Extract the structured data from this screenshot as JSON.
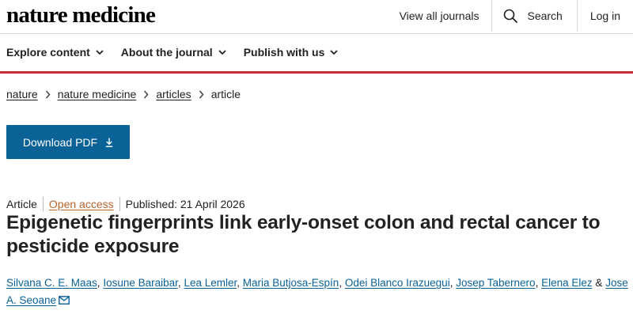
{
  "header": {
    "logo": "nature medicine",
    "view_all_journals": "View all journals",
    "search_label": "Search",
    "login_label": "Log in"
  },
  "subnav": {
    "explore": "Explore content",
    "about": "About the journal",
    "publish": "Publish with us"
  },
  "breadcrumb": {
    "items": [
      "nature",
      "nature medicine",
      "articles"
    ],
    "current": "article"
  },
  "download": {
    "label": "Download PDF"
  },
  "meta": {
    "type": "Article",
    "access": "Open access",
    "published": "Published: 21 April 2026"
  },
  "article": {
    "title": "Epigenetic fingerprints link early-onset colon and rectal cancer to pesticide exposure"
  },
  "authors": {
    "list": [
      "Silvana C. E. Maas",
      "Iosune Baraibar",
      "Lea Lemler",
      "Maria Butjosa-Espín",
      "Odei Blanco Irazuegui",
      "Josep Tabernero",
      "Elena Elez",
      "Jose A. Seoane"
    ],
    "separator": ",",
    "last_joiner": "&"
  },
  "colors": {
    "brand_red": "#c42a37",
    "button_blue": "#0a6297",
    "open_access_orange": "#b9632a",
    "link_blue": "#0a6297"
  },
  "icons": {
    "search": "search-icon",
    "chevron": "chevron-down-icon",
    "breadcrumb_sep": "chevron-right-icon",
    "download": "download-arrow-icon",
    "mail": "mail-icon"
  }
}
